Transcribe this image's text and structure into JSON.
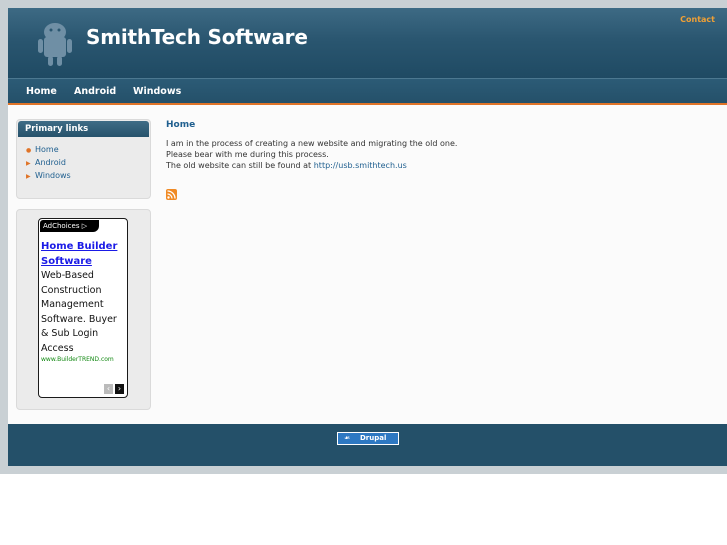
{
  "header": {
    "site_name": "SmithTech Software",
    "contact_label": "Contact"
  },
  "nav": {
    "items": [
      {
        "label": "Home"
      },
      {
        "label": "Android"
      },
      {
        "label": "Windows"
      }
    ]
  },
  "sidebar": {
    "primary_links": {
      "title": "Primary links",
      "items": [
        {
          "label": "Home"
        },
        {
          "label": "Android"
        },
        {
          "label": "Windows"
        }
      ]
    },
    "ad": {
      "adchoices_label": "AdChoices",
      "headline": "Home Builder Software",
      "body": "Web-Based Construction Management Software. Buyer & Sub Login Access",
      "url": "www.BuilderTREND.com"
    }
  },
  "content": {
    "title": "Home",
    "line1": "I am in the process of creating a new website and migrating the old one.",
    "line2": "Please bear with me during this process.",
    "line3_prefix": "The old website can still be found at ",
    "line3_link": "http://usb.smithtech.us"
  },
  "footer": {
    "badge_label": "Drupal"
  },
  "colors": {
    "header_blue": "#2a5670",
    "accent_orange": "#e07428",
    "link_blue": "#1f5f8f",
    "contact_orange": "#f0a035"
  },
  "icons": [
    "android-logo-icon",
    "rss-feed-icon",
    "adchoices-icon",
    "drupal-logo-icon"
  ]
}
